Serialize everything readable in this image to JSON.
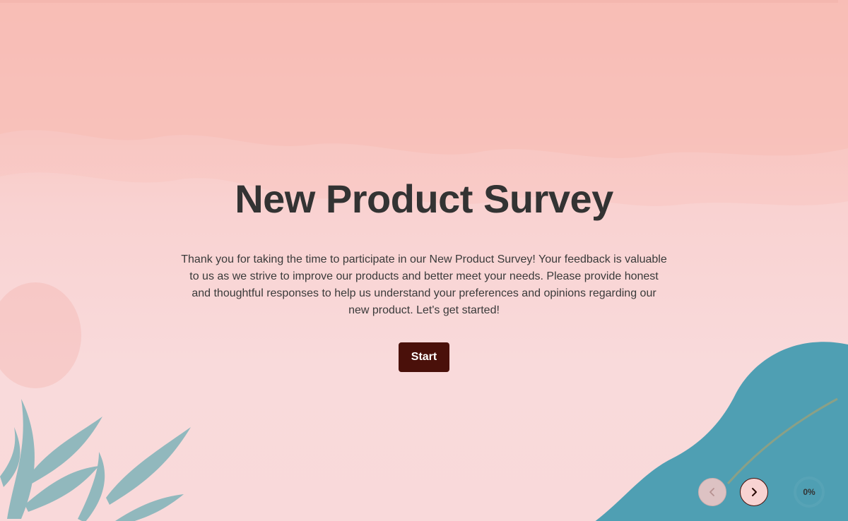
{
  "survey": {
    "title": "New Product Survey",
    "description": "Thank you for taking the time to participate in our New Product Survey! Your feedback is valuable to us as we strive to improve our products and better meet your needs. Please provide honest and thoughtful responses to help us understand your preferences and opinions regarding our new product. Let's get started!",
    "start_label": "Start"
  },
  "navigation": {
    "prev_icon": "chevron-left-icon",
    "next_icon": "chevron-right-icon"
  },
  "progress": {
    "label": "0%",
    "value": 0
  },
  "colors": {
    "accent": "#4a100a",
    "background": "#f9d2d1",
    "leaf": "#7fb3b8",
    "wave": "#4f9fb3"
  }
}
